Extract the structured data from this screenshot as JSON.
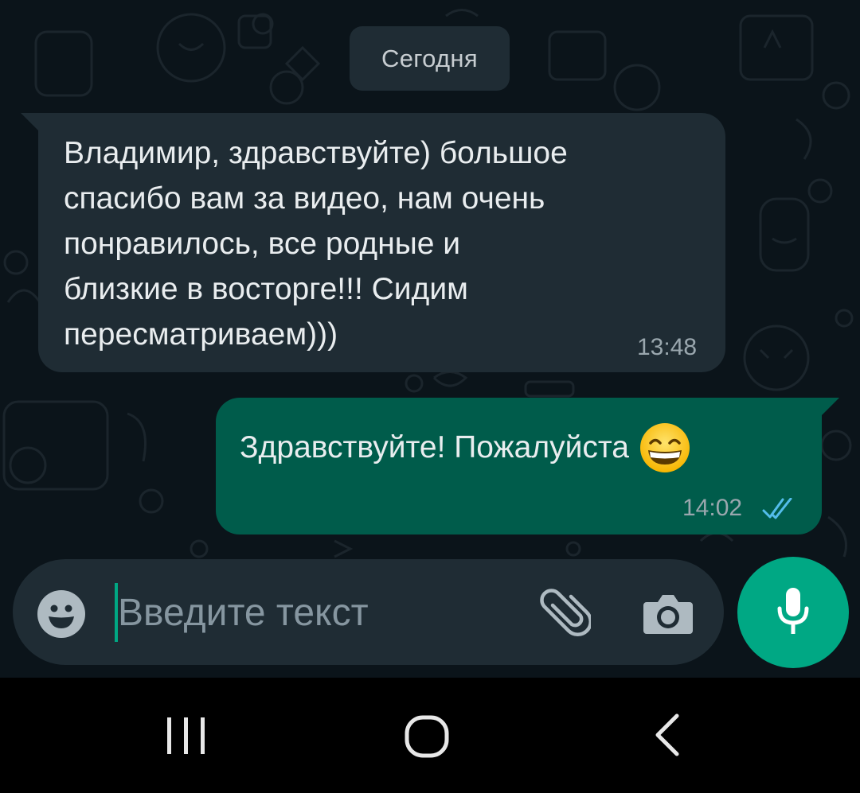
{
  "date_chip": "Сегодня",
  "messages": [
    {
      "direction": "incoming",
      "lines": [
        "Владимир, здравствуйте) большое",
        "спасибо вам за видео, нам очень",
        "понравилось, все родные и",
        "близкие в восторге!!! Сидим",
        "пересматриваем)))"
      ],
      "time": "13:48"
    },
    {
      "direction": "outgoing",
      "text": "Здравствуйте! Пожалуйста",
      "emoji": "grinning-face-with-smiling-eyes",
      "time": "14:02",
      "status": "read"
    }
  ],
  "composer": {
    "placeholder": "Введите текст"
  },
  "colors": {
    "background": "#0b141a",
    "incoming_bubble": "#1f2c34",
    "outgoing_bubble": "#005c4b",
    "accent": "#00a884",
    "read_ticks": "#53bdeb"
  },
  "icons": {
    "emoji": "smiley-icon",
    "attach": "paperclip-icon",
    "camera": "camera-icon",
    "mic": "mic-icon",
    "nav_recent": "recent-apps-icon",
    "nav_home": "home-icon",
    "nav_back": "back-icon"
  }
}
